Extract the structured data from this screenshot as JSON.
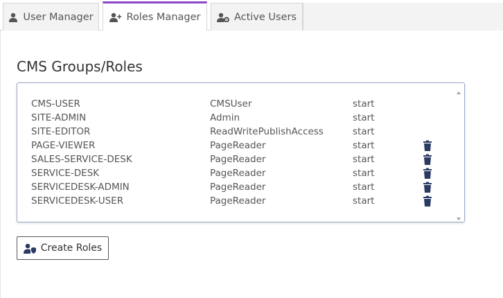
{
  "tabs": [
    {
      "label": "User Manager",
      "icon": "user-icon",
      "active": false
    },
    {
      "label": "Roles Manager",
      "icon": "user-plus-icon",
      "active": true
    },
    {
      "label": "Active Users",
      "icon": "user-gear-icon",
      "active": false
    }
  ],
  "section": {
    "title": "CMS Groups/Roles"
  },
  "roles": [
    {
      "name": "CMS-USER",
      "access": "CMSUser",
      "start": "start",
      "deletable": false
    },
    {
      "name": "SITE-ADMIN",
      "access": "Admin",
      "start": "start",
      "deletable": false
    },
    {
      "name": "SITE-EDITOR",
      "access": "ReadWritePublishAccess",
      "start": "start",
      "deletable": false
    },
    {
      "name": "PAGE-VIEWER",
      "access": "PageReader",
      "start": "start",
      "deletable": true
    },
    {
      "name": "SALES-SERVICE-DESK",
      "access": "PageReader",
      "start": "start",
      "deletable": true
    },
    {
      "name": "SERVICE-DESK",
      "access": "PageReader",
      "start": "start",
      "deletable": true
    },
    {
      "name": "SERVICEDESK-ADMIN",
      "access": "PageReader",
      "start": "start",
      "deletable": true
    },
    {
      "name": "SERVICEDESK-USER",
      "access": "PageReader",
      "start": "start",
      "deletable": true
    }
  ],
  "actions": {
    "create_label": "Create Roles",
    "create_icon": "user-shield-icon"
  },
  "colors": {
    "accent": "#8a45c8",
    "icon": "#2b3a63",
    "listbox_border": "#9aa9c9"
  }
}
